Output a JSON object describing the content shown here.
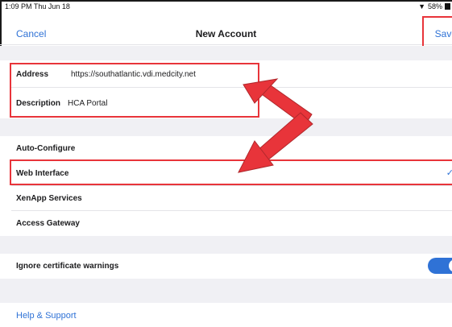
{
  "status": {
    "time": "1:09 PM  Thu Jun 18",
    "battery": "58%"
  },
  "nav": {
    "cancel": "Cancel",
    "title": "New Account",
    "save": "Save"
  },
  "fields": {
    "address_label": "Address",
    "address_value": "https://southatlantic.vdi.medcity.net",
    "description_label": "Description",
    "description_value": "HCA Portal"
  },
  "options": {
    "auto_configure": "Auto-Configure",
    "web_interface": "Web Interface",
    "xenapp_services": "XenApp Services",
    "access_gateway": "Access Gateway",
    "selected_icon": "checkmark-icon"
  },
  "settings": {
    "ignore_certificate_warnings": "Ignore certificate warnings",
    "toggle_on": true
  },
  "help": {
    "label": "Help & Support"
  },
  "colors": {
    "accent": "#2f72d6",
    "highlight": "#e8343a",
    "background": "#f0f0f4"
  }
}
